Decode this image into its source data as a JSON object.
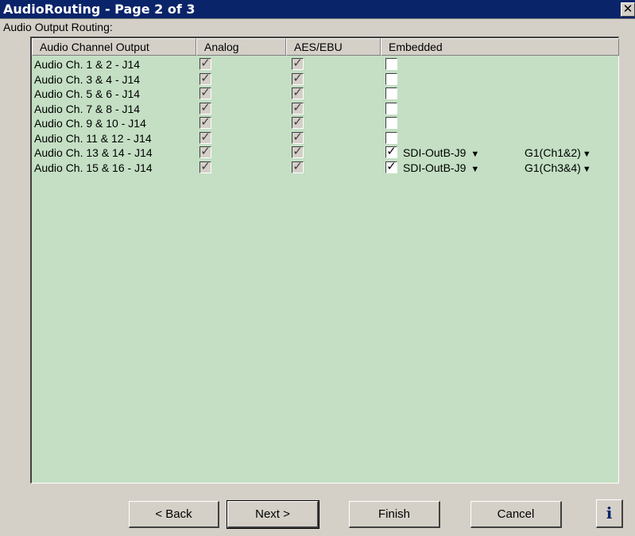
{
  "window": {
    "title": "AudioRouting - Page 2 of 3",
    "close": "✕"
  },
  "section_label": "Audio Output Routing:",
  "table": {
    "headers": [
      "Audio Channel Output",
      "Analog",
      "AES/EBU",
      "Embedded"
    ],
    "rows": [
      {
        "label": "Audio Ch. 1 & 2 - J14",
        "analog": true,
        "aes": true,
        "embedded": false,
        "sdi": "",
        "group": ""
      },
      {
        "label": "Audio Ch. 3 & 4 - J14",
        "analog": true,
        "aes": true,
        "embedded": false,
        "sdi": "",
        "group": ""
      },
      {
        "label": "Audio Ch. 5 & 6 - J14",
        "analog": true,
        "aes": true,
        "embedded": false,
        "sdi": "",
        "group": ""
      },
      {
        "label": "Audio Ch. 7 & 8 - J14",
        "analog": true,
        "aes": true,
        "embedded": false,
        "sdi": "",
        "group": ""
      },
      {
        "label": "Audio Ch. 9 & 10 - J14",
        "analog": true,
        "aes": true,
        "embedded": false,
        "sdi": "",
        "group": ""
      },
      {
        "label": "Audio Ch. 11 & 12 - J14",
        "analog": true,
        "aes": true,
        "embedded": false,
        "sdi": "",
        "group": ""
      },
      {
        "label": "Audio Ch. 13 & 14 - J14",
        "analog": true,
        "aes": true,
        "embedded": true,
        "sdi": "SDI-OutB-J9",
        "group": "G1(Ch1&2)"
      },
      {
        "label": "Audio Ch. 15 & 16 - J14",
        "analog": true,
        "aes": true,
        "embedded": true,
        "sdi": "SDI-OutB-J9",
        "group": "G1(Ch3&4)"
      }
    ]
  },
  "buttons": {
    "back": "< Back",
    "next": "Next >",
    "finish": "Finish",
    "cancel": "Cancel",
    "info": "i"
  },
  "colors": {
    "titlebar": "#0a246a",
    "grid_bg": "#c4dfc4",
    "dialog_bg": "#d4d0c8"
  }
}
